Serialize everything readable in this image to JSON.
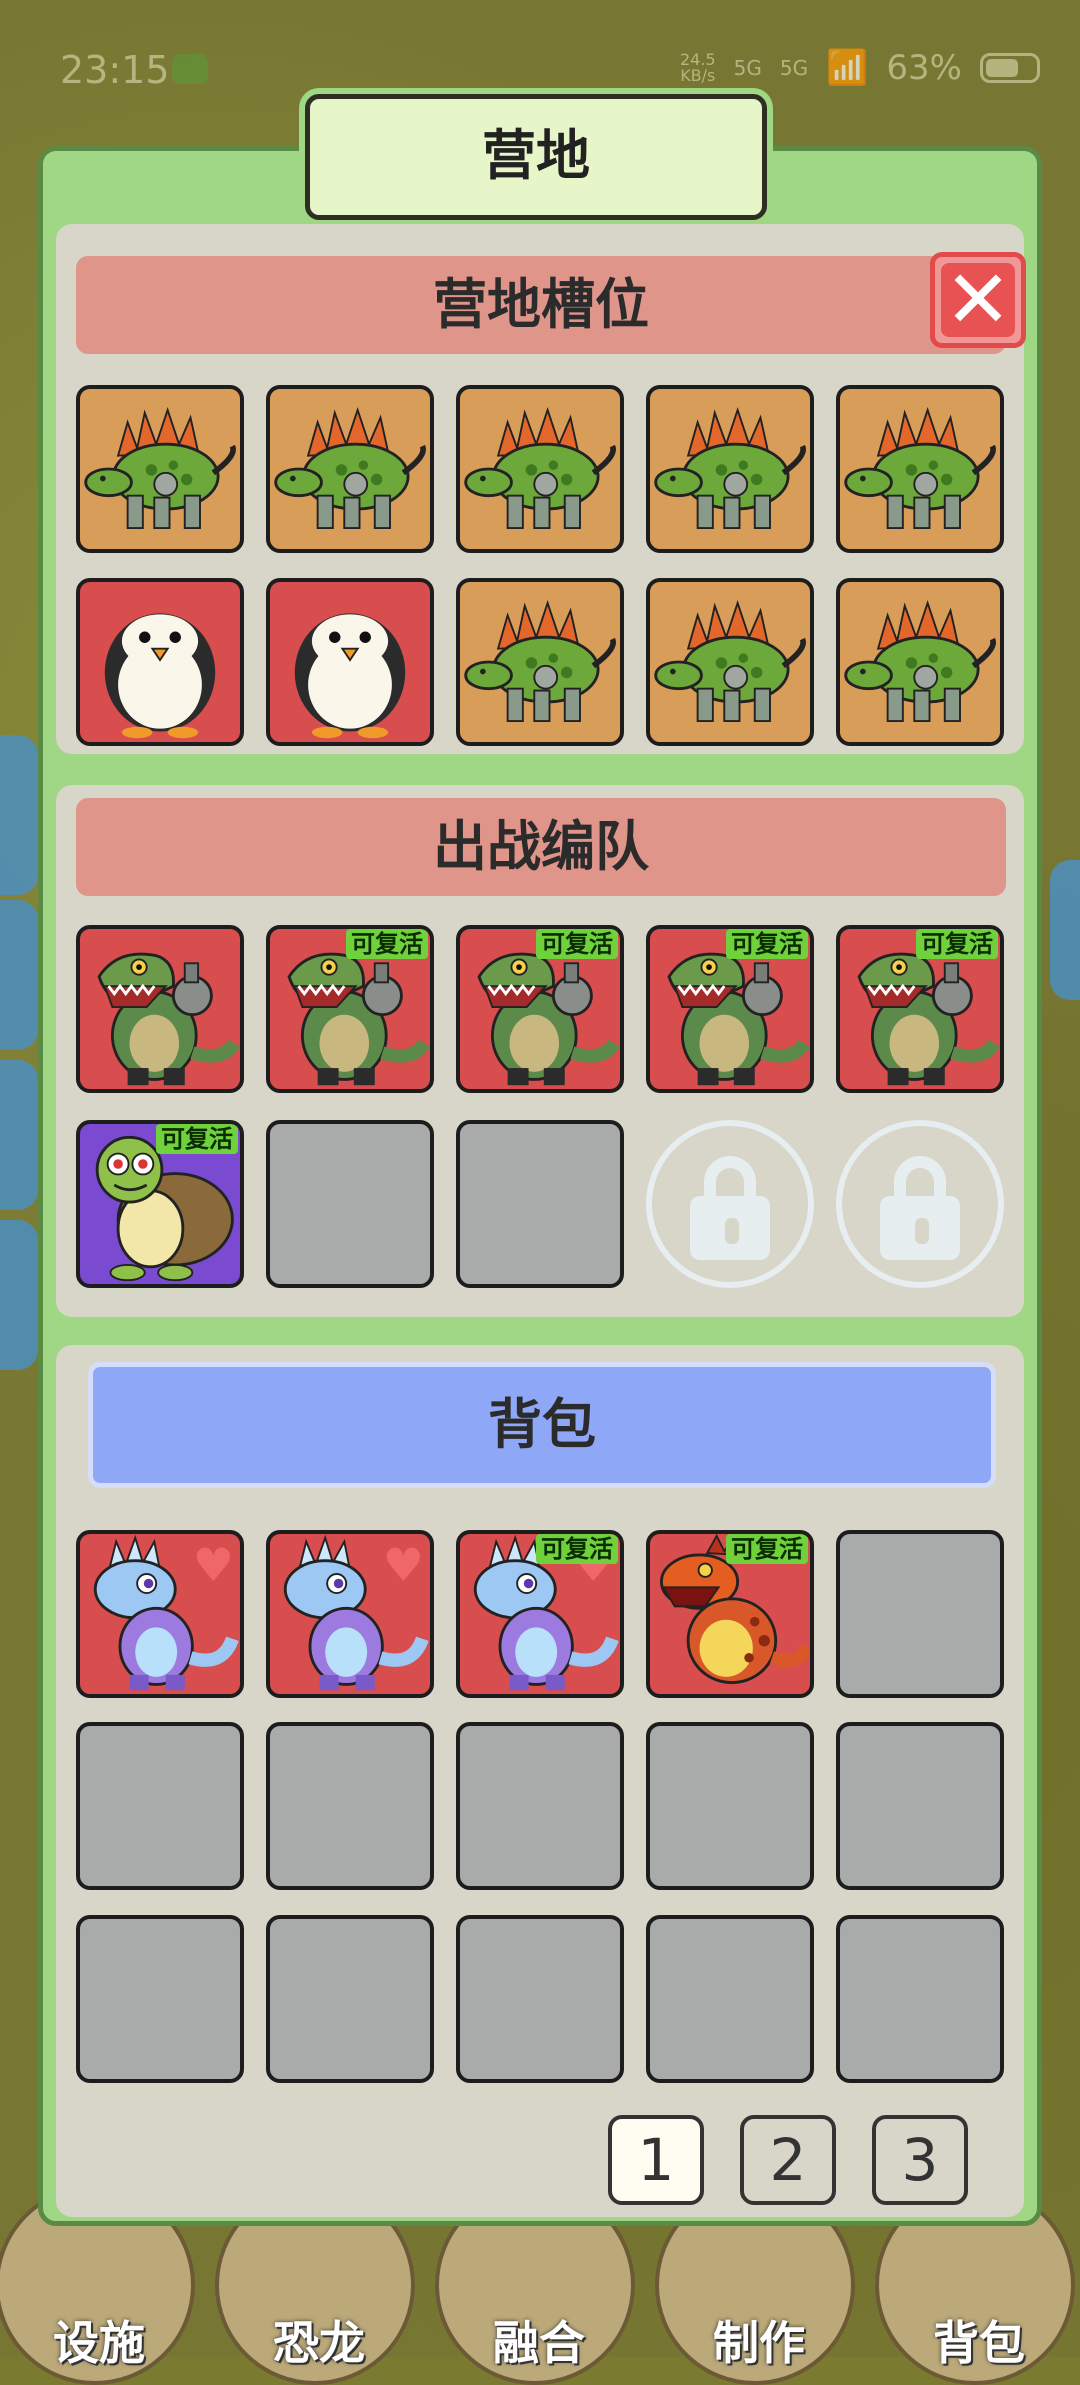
{
  "status_bar": {
    "time": "23:15",
    "net_speed": "24.5\nKB/s",
    "signal1": "5G",
    "signal2": "5G",
    "battery": "63%"
  },
  "title": "营地",
  "camp_slots": {
    "header": "营地槽位",
    "rows": [
      [
        {
          "type": "stegosaurus"
        },
        {
          "type": "stegosaurus"
        },
        {
          "type": "stegosaurus"
        },
        {
          "type": "stegosaurus"
        },
        {
          "type": "stegosaurus"
        }
      ],
      [
        {
          "type": "penguin"
        },
        {
          "type": "penguin"
        },
        {
          "type": "stegosaurus"
        },
        {
          "type": "stegosaurus"
        },
        {
          "type": "stegosaurus"
        }
      ]
    ]
  },
  "battle_team": {
    "header": "出战编队",
    "revive_label": "可复活"
  },
  "backpack": {
    "header": "背包",
    "revive_label": "可复活"
  },
  "pagination": [
    "1",
    "2",
    "3"
  ],
  "active_page": "1",
  "bottom_nav": [
    "设施",
    "恐龙",
    "融合",
    "制作",
    "背包"
  ]
}
